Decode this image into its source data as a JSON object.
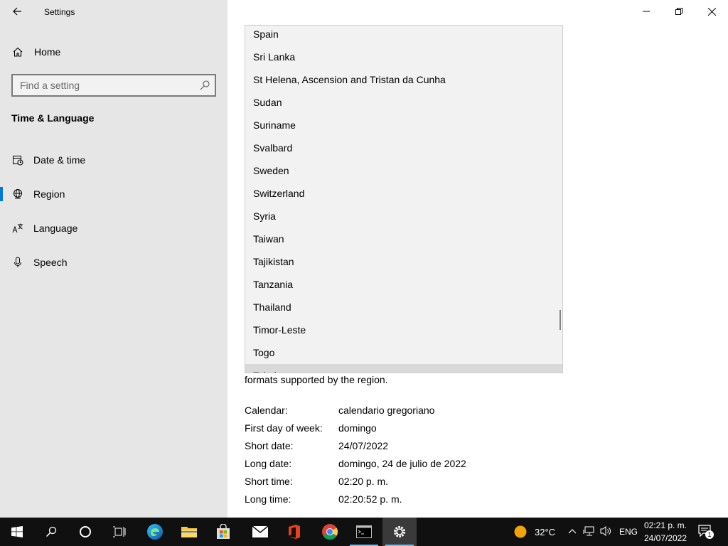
{
  "window": {
    "title": "Settings",
    "controls": [
      "minimize",
      "maximize",
      "close"
    ]
  },
  "sidebar": {
    "home_label": "Home",
    "search_placeholder": "Find a setting",
    "section_title": "Time & Language",
    "items": [
      {
        "label": "Date & time",
        "icon": "calendar-clock-icon",
        "active": false
      },
      {
        "label": "Region",
        "icon": "globe-icon",
        "active": true
      },
      {
        "label": "Language",
        "icon": "language-icon",
        "active": false
      },
      {
        "label": "Speech",
        "icon": "microphone-icon",
        "active": false
      }
    ]
  },
  "region_dropdown": {
    "items": [
      "Spain",
      "Sri Lanka",
      "St Helena, Ascension and Tristan da Cunha",
      "Sudan",
      "Suriname",
      "Svalbard",
      "Sweden",
      "Switzerland",
      "Syria",
      "Taiwan",
      "Tajikistan",
      "Tanzania",
      "Thailand",
      "Timor-Leste",
      "Togo",
      "Tokelau"
    ]
  },
  "regional_format": {
    "description_tail": "formats supported by the region.",
    "rows": [
      {
        "key": "Calendar:",
        "value": "calendario gregoriano"
      },
      {
        "key": "First day of week:",
        "value": "domingo"
      },
      {
        "key": "Short date:",
        "value": "24/07/2022"
      },
      {
        "key": "Long date:",
        "value": "domingo, 24 de julio de 2022"
      },
      {
        "key": "Short time:",
        "value": "02:20 p. m."
      },
      {
        "key": "Long time:",
        "value": "02:20:52 p. m."
      }
    ]
  },
  "taskbar": {
    "apps": [
      "start",
      "search",
      "cortana",
      "task-view",
      "edge",
      "file-explorer",
      "store",
      "mail",
      "office",
      "chrome",
      "terminal",
      "settings"
    ],
    "weather_temp": "32°C",
    "language": "ENG",
    "time": "02:21 p. m.",
    "date": "24/07/2022",
    "notification_count": "1"
  },
  "colors": {
    "accent": "#0078d7",
    "sidebar_bg": "#e6e6e6",
    "taskbar_bg": "#101010"
  }
}
